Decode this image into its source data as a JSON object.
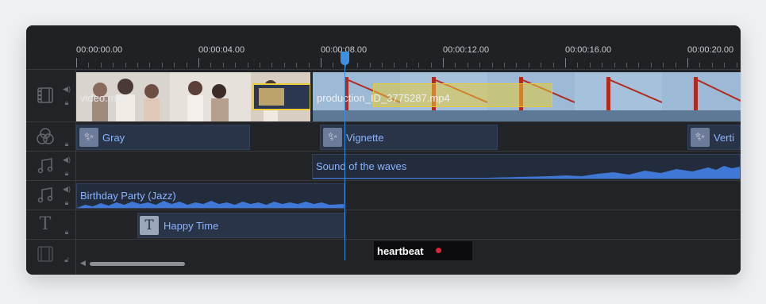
{
  "timeline": {
    "ticks": [
      "00:00:00.00",
      "00:00:04.00",
      "00:00:08.00",
      "00:00:12.00",
      "00:00:16.00",
      "00:00:20.00"
    ],
    "tracks": {
      "video": {
        "clip1": "video.mp4",
        "clip2": "production_ID_3775287.mp4"
      },
      "effects": {
        "gray": "Gray",
        "vignette": "Vignette",
        "vertical": "Verti"
      },
      "audio1": {
        "clip": "Sound of the waves"
      },
      "audio2": {
        "clip": "Birthday Party (Jazz)"
      },
      "text": {
        "clip": "Happy Time"
      },
      "bottom": {
        "clip": "heartbeat"
      }
    }
  },
  "icons": {
    "video_track": "film-icon",
    "effect_track": "effects-circles-icon",
    "audio_track": "music-note-icon",
    "text_track": "text-t-icon",
    "lock": "lock-icon",
    "speaker": "speaker-icon",
    "wand": "magic-wand-icon"
  },
  "colors": {
    "playhead": "#3d8fe0",
    "clip_text": "#8ab4ff",
    "selection": "#e8cb3a"
  }
}
